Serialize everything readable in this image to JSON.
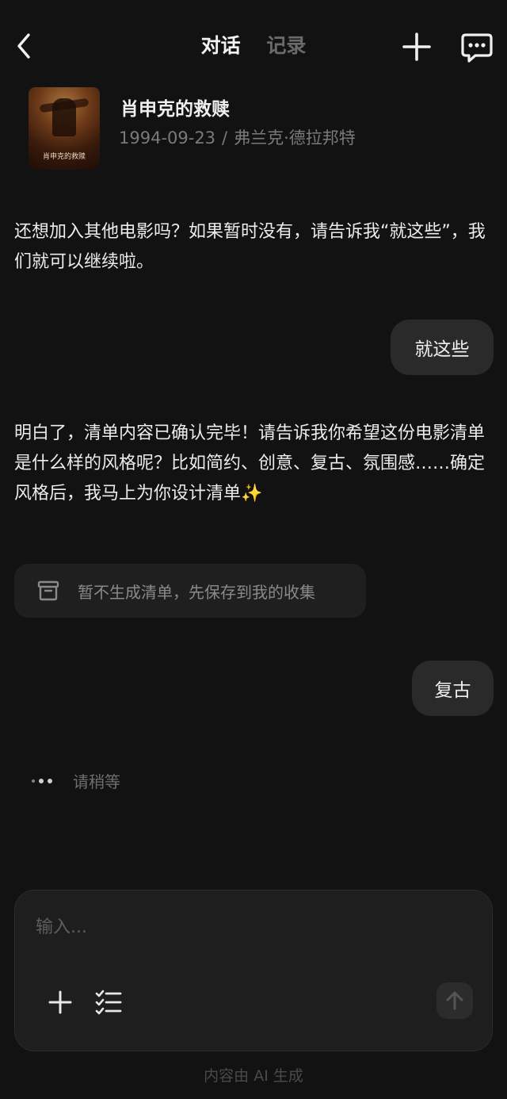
{
  "header": {
    "tabs": [
      {
        "label": "对话",
        "active": true
      },
      {
        "label": "记录",
        "active": false
      }
    ],
    "icons": {
      "back": "chevron-left-icon",
      "add": "plus-icon",
      "chat": "chat-bubble-icon"
    }
  },
  "movie": {
    "title": "肖申克的救赎",
    "poster_text": "肖申克的救赎",
    "date": "1994-09-23",
    "separator": "/",
    "director": "弗兰克·德拉邦特"
  },
  "messages": [
    {
      "role": "ai",
      "text": "还想加入其他电影吗？如果暂时没有，请告诉我“就这些”，我们就可以继续啦。"
    },
    {
      "role": "user",
      "text": "就这些"
    },
    {
      "role": "ai",
      "text": "明白了，清单内容已确认完毕！请告诉我你希望这份电影清单是什么样的风格呢？比如简约、创意、复古、氛围感……确定风格后，我马上为你设计清单✨"
    },
    {
      "role": "user",
      "text": "复古"
    }
  ],
  "save_chip": {
    "label": "暂不生成清单，先保存到我的收集",
    "icon": "archive-box-icon"
  },
  "typing": {
    "label": "请稍等"
  },
  "composer": {
    "placeholder": "输入...",
    "icons": {
      "plus": "plus-icon",
      "list": "checklist-icon",
      "send": "arrow-up-icon"
    }
  },
  "footer": {
    "note": "内容由 AI 生成"
  },
  "colors": {
    "background": "#121212",
    "bubble": "#2a2a2a",
    "muted": "#7a7a7a"
  }
}
